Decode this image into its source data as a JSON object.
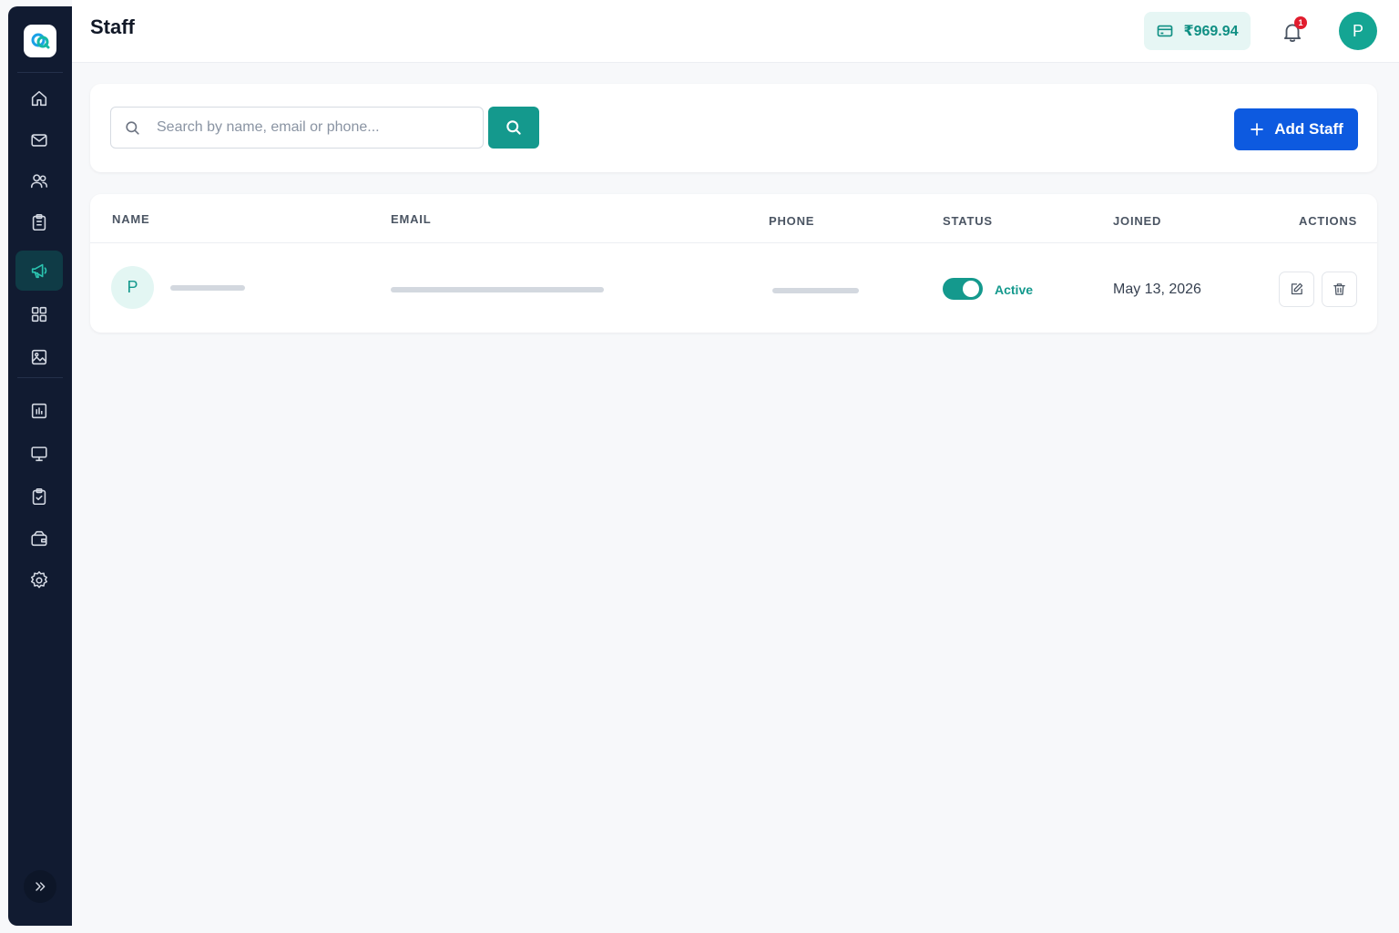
{
  "header": {
    "title": "Staff",
    "wallet_balance": "₹969.94",
    "notification_count": "1",
    "user_initial": "P"
  },
  "sidebar": {
    "items": [
      {
        "icon": "home-icon"
      },
      {
        "icon": "mail-icon"
      },
      {
        "icon": "users-icon"
      },
      {
        "icon": "clipboard-icon"
      },
      {
        "icon": "megaphone-icon",
        "active": true
      },
      {
        "icon": "grid-icon"
      },
      {
        "icon": "image-icon"
      },
      {
        "icon": "bar-chart-icon"
      },
      {
        "icon": "monitor-icon"
      },
      {
        "icon": "clipboard-check-icon"
      },
      {
        "icon": "wallet-icon"
      },
      {
        "icon": "settings-icon"
      }
    ],
    "collapse_icon": "chevrons-right-icon"
  },
  "search": {
    "placeholder": "Search by name, email or phone...",
    "value": ""
  },
  "actions": {
    "add_label": "Add Staff"
  },
  "table": {
    "columns": [
      "NAME",
      "EMAIL",
      "PHONE",
      "STATUS",
      "JOINED",
      "ACTIONS"
    ],
    "rows": [
      {
        "initial": "P",
        "status": "Active",
        "status_on": true,
        "joined": "May 13, 2026"
      }
    ]
  },
  "colors": {
    "sidebar_bg": "#111b31",
    "accent_teal": "#14998d",
    "primary_blue": "#0d5ae0",
    "badge_red": "#e11d2e"
  }
}
